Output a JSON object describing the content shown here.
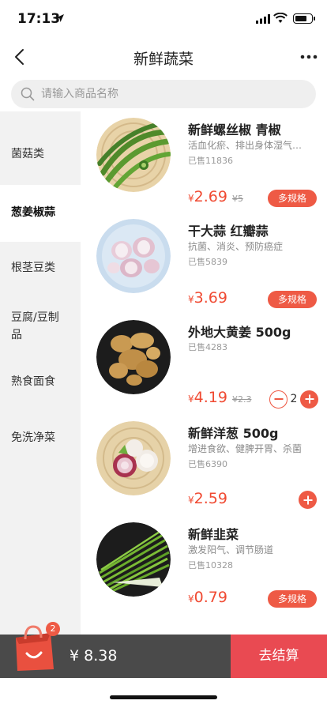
{
  "status_bar": {
    "time": "17:13"
  },
  "nav": {
    "title": "新鲜蔬菜"
  },
  "search": {
    "placeholder": "请输入商品名称"
  },
  "sidebar": {
    "items": [
      {
        "label": "菌菇类",
        "active": false
      },
      {
        "label": "葱姜椒蒜",
        "active": true
      },
      {
        "label": "根茎豆类",
        "active": false
      },
      {
        "label": "豆腐/豆制品",
        "active": false
      },
      {
        "label": "熟食面食",
        "active": false
      },
      {
        "label": "免洗净菜",
        "active": false
      }
    ]
  },
  "products": [
    {
      "name": "新鲜螺丝椒 青椒",
      "desc": "活血化瘀、排出身体湿气…",
      "sold": "已售11836",
      "currency": "¥",
      "price": "2.69",
      "old_price": "¥5",
      "action": "多规格",
      "image": "green-peppers"
    },
    {
      "name": "干大蒜 红瓣蒜",
      "desc": "抗菌、消炎、预防癌症",
      "sold": "已售5839",
      "currency": "¥",
      "price": "3.69",
      "old_price": "",
      "action": "多规格",
      "image": "garlic"
    },
    {
      "name": "外地大黄姜 500g",
      "desc": "",
      "sold": "已售4283",
      "currency": "¥",
      "price": "4.19",
      "old_price": "¥2.3",
      "action": "stepper",
      "quantity": "2",
      "image": "ginger"
    },
    {
      "name": "新鲜洋葱 500g",
      "desc": "增进食欲、健脾开胃、杀菌",
      "sold": "已售6390",
      "currency": "¥",
      "price": "2.59",
      "old_price": "",
      "action": "plus",
      "image": "onion"
    },
    {
      "name": "新鲜韭菜",
      "desc": "激发阳气、调节肠道",
      "sold": "已售10328",
      "currency": "¥",
      "price": "0.79",
      "old_price": "",
      "action": "多规格",
      "image": "chives"
    }
  ],
  "cart": {
    "badge_count": "2",
    "total": "¥ 8.38",
    "checkout_label": "去结算"
  },
  "colors": {
    "accent": "#ee5a45",
    "checkout": "#e94a52",
    "cart_bar": "#4a4a4a",
    "sidebar_bg": "#f2f2f2"
  }
}
